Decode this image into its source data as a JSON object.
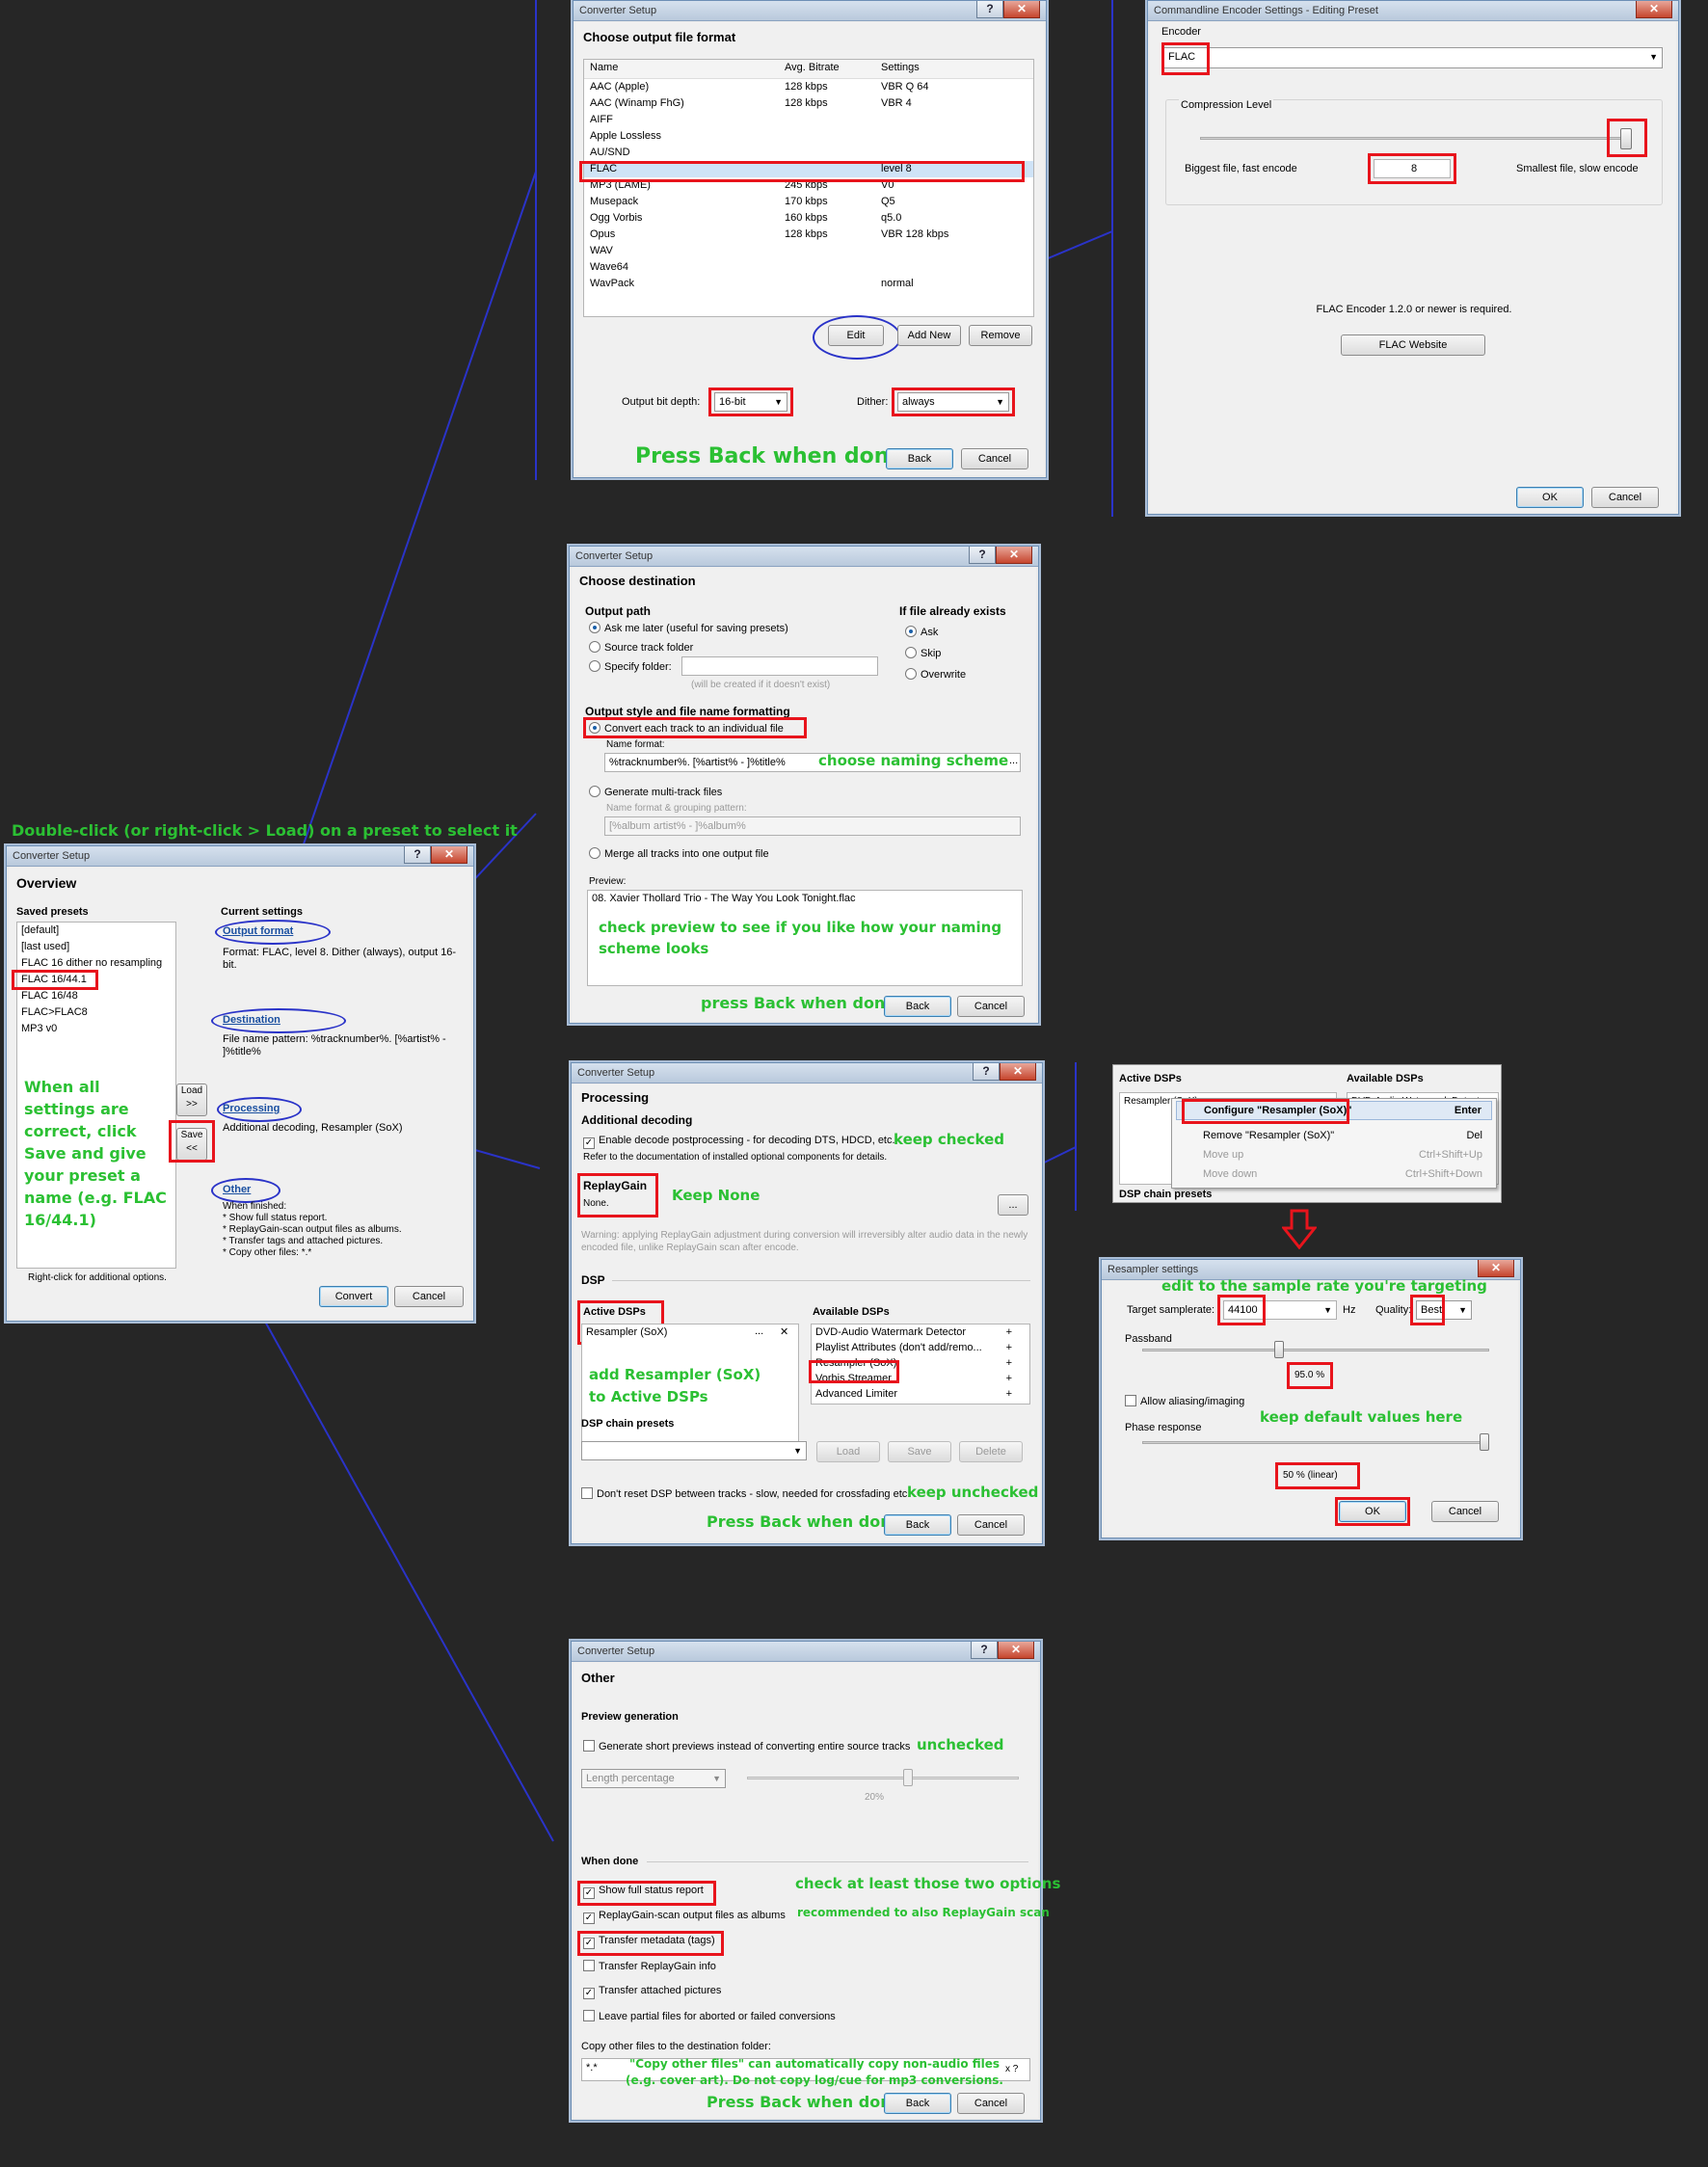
{
  "annotation": {
    "top_instruction": "Double-click (or right-click > Load) on a preset to select it",
    "save_instruction": "When all settings are correct, click Save and give your preset a name (e.g. FLAC 16/44.1)",
    "press_back_done": "Press Back when done",
    "press_back_done_lower": "press Back when done",
    "choose_naming": "choose naming scheme",
    "check_preview": "check preview to see if you like how your naming scheme looks",
    "keep_checked": "keep checked",
    "keep_none": "Keep None",
    "add_resampler": "add Resampler (SoX) to Active DSPs",
    "keep_unchecked": "keep unchecked",
    "edit_samplerate": "edit to the sample rate you're targeting",
    "keep_default": "keep default values here",
    "unchecked": "unchecked",
    "check_two": "check at least those two options",
    "recommended_rg": "recommended to also ReplayGain scan",
    "copy_other": "\"Copy other files\" can automatically copy non-audio files (e.g. cover art). Do not copy log/cue for mp3 conversions."
  },
  "overview": {
    "title": "Converter Setup",
    "heading": "Overview",
    "saved_presets_label": "Saved presets",
    "presets": [
      "[default]",
      "[last used]",
      "FLAC 16 dither no resampling",
      "FLAC 16/44.1",
      "FLAC 16/48",
      "FLAC>FLAC8",
      "MP3 v0"
    ],
    "current_settings_label": "Current settings",
    "output_format_link": "Output format",
    "output_format_text": "Format: FLAC, level 8. Dither (always), output 16-bit.",
    "destination_link": "Destination",
    "destination_text": "File name pattern: %tracknumber%. [%artist% - ]%title%",
    "processing_link": "Processing",
    "processing_text": "Additional decoding, Resampler (SoX)",
    "other_link": "Other",
    "other_text": [
      "When finished:",
      "* Show full status report.",
      "* ReplayGain-scan output files as albums.",
      "* Transfer tags and attached pictures.",
      "* Copy other files: *.*"
    ],
    "load_button": "Load >>",
    "save_button": "Save <<",
    "right_click_hint": "Right-click for additional options.",
    "convert_button": "Convert",
    "cancel_button": "Cancel"
  },
  "format": {
    "title": "Converter Setup",
    "heading": "Choose output file format",
    "columns": [
      "Name",
      "Avg. Bitrate",
      "Settings"
    ],
    "rows": [
      [
        "AAC (Apple)",
        "128 kbps",
        "VBR Q 64"
      ],
      [
        "AAC (Winamp FhG)",
        "128 kbps",
        "VBR 4"
      ],
      [
        "AIFF",
        "",
        ""
      ],
      [
        "Apple Lossless",
        "",
        ""
      ],
      [
        "AU/SND",
        "",
        ""
      ],
      [
        "FLAC",
        "",
        "level 8"
      ],
      [
        "MP3 (LAME)",
        "245 kbps",
        "V0"
      ],
      [
        "Musepack",
        "170 kbps",
        "Q5"
      ],
      [
        "Ogg Vorbis",
        "160 kbps",
        "q5.0"
      ],
      [
        "Opus",
        "128 kbps",
        "VBR 128 kbps"
      ],
      [
        "WAV",
        "",
        ""
      ],
      [
        "Wave64",
        "",
        ""
      ],
      [
        "WavPack",
        "",
        "normal"
      ]
    ],
    "edit_button": "Edit",
    "add_button": "Add New",
    "remove_button": "Remove",
    "bitdepth_label": "Output bit depth:",
    "bitdepth_value": "16-bit",
    "dither_label": "Dither:",
    "dither_value": "always",
    "back_button": "Back",
    "cancel_button": "Cancel"
  },
  "encoder": {
    "title": "Commandline Encoder Settings - Editing Preset",
    "encoder_label": "Encoder",
    "encoder_value": "FLAC",
    "compression_label": "Compression Level",
    "left_label": "Biggest file, fast encode",
    "level_value": "8",
    "right_label": "Smallest file, slow encode",
    "requirement": "FLAC Encoder 1.2.0 or newer is required.",
    "website_button": "FLAC Website",
    "ok_button": "OK",
    "cancel_button": "Cancel",
    "compression_level": 8,
    "compression_max": 8
  },
  "destination": {
    "title": "Converter Setup",
    "heading": "Choose destination",
    "output_path_label": "Output path",
    "path_options": [
      "Ask me later (useful for saving presets)",
      "Source track folder",
      "Specify folder:"
    ],
    "folder_hint": "(will be created if it doesn't exist)",
    "exists_label": "If file already exists",
    "exists_options": [
      "Ask",
      "Skip",
      "Overwrite"
    ],
    "style_label": "Output style and file name formatting",
    "convert_each": "Convert each track to an individual file",
    "name_format_label": "Name format:",
    "name_format_value": "%tracknumber%. [%artist% - ]%title%",
    "ellipsis": "...",
    "multi_track": "Generate multi-track files",
    "grouping_label": "Name format & grouping pattern:",
    "grouping_value": "[%album artist% - ]%album%",
    "merge": "Merge all tracks into one output file",
    "preview_label": "Preview:",
    "preview_value": "08. Xavier Thollard Trio - The Way You Look Tonight.flac",
    "back_button": "Back",
    "cancel_button": "Cancel"
  },
  "processing": {
    "title": "Converter Setup",
    "heading": "Processing",
    "additional_label": "Additional decoding",
    "enable_decode": "Enable decode postprocessing - for decoding DTS, HDCD, etc.",
    "refer": "Refer to the documentation of installed optional components for details.",
    "replaygain_label": "ReplayGain",
    "replaygain_value": "None.",
    "rg_button": "...",
    "warning": "Warning: applying ReplayGain adjustment during conversion will irreversibly alter audio data in the newly encoded file, unlike ReplayGain scan after encode.",
    "dsp_label": "DSP",
    "active_label": "Active DSPs",
    "active_items": [
      "Resampler (SoX)"
    ],
    "available_label": "Available DSPs",
    "available_items": [
      "DVD-Audio Watermark Detector",
      "Playlist Attributes (don't add/remo...",
      "Resampler (SoX)",
      "Vorbis Streamer",
      "Advanced Limiter"
    ],
    "chain_label": "DSP chain presets",
    "load_button": "Load",
    "save_button": "Save",
    "delete_button": "Delete",
    "dont_reset": "Don't reset DSP between tracks - slow, needed for crossfading etc.",
    "back_button": "Back",
    "cancel_button": "Cancel"
  },
  "context": {
    "active_label": "Active DSPs",
    "available_label": "Available DSPs",
    "active_item": "Resampler (SoX)",
    "available_item": "DVD-Audio Watermark Detector",
    "chain_label": "DSP chain presets",
    "menu": [
      {
        "label": "Configure \"Resampler (SoX)\"",
        "shortcut": "Enter"
      },
      {
        "label": "Remove \"Resampler (SoX)\"",
        "shortcut": "Del"
      },
      {
        "label": "Move up",
        "shortcut": "Ctrl+Shift+Up"
      },
      {
        "label": "Move down",
        "shortcut": "Ctrl+Shift+Down"
      }
    ]
  },
  "resampler": {
    "title": "Resampler settings",
    "target_label": "Target samplerate:",
    "target_value": "44100",
    "hz": "Hz",
    "quality_label": "Quality:",
    "quality_value": "Best",
    "passband_label": "Passband",
    "passband_value": "95.0 %",
    "aliasing": "Allow aliasing/imaging",
    "phase_label": "Phase response",
    "phase_value": "50 % (linear)",
    "ok_button": "OK",
    "cancel_button": "Cancel",
    "passband_level": 0.95,
    "phase_level": 1.0
  },
  "other": {
    "title": "Converter Setup",
    "heading": "Other",
    "preview_gen_label": "Preview generation",
    "generate_short": "Generate short previews instead of converting entire source tracks",
    "length_value": "Length percentage",
    "percent_value": "20%",
    "when_done_label": "When done",
    "options": [
      {
        "label": "Show full status report",
        "checked": true
      },
      {
        "label": "ReplayGain-scan output files as albums",
        "checked": true
      },
      {
        "label": "Transfer metadata (tags)",
        "checked": true
      },
      {
        "label": "Transfer ReplayGain info",
        "checked": false
      },
      {
        "label": "Transfer attached pictures",
        "checked": true
      },
      {
        "label": "Leave partial files for aborted or failed conversions",
        "checked": false
      }
    ],
    "copy_label": "Copy other files to the destination folder:",
    "copy_value": "*.*",
    "clear_icon": "x ?",
    "back_button": "Back",
    "cancel_button": "Cancel"
  },
  "colors": {
    "background": "#262626",
    "annotation_green": "#2bc033",
    "highlight_red": "#e8141c",
    "connector_blue": "#2a33c8"
  }
}
